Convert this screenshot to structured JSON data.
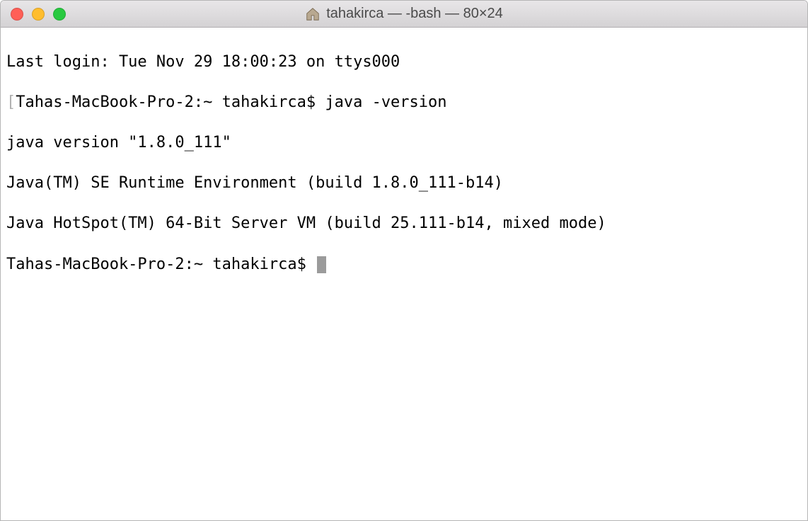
{
  "window": {
    "title": "tahakirca — -bash — 80×24"
  },
  "terminal": {
    "line1": "Last login: Tue Nov 29 18:00:23 on ttys000",
    "line2_prompt": "Tahas-MacBook-Pro-2:~ tahakirca$ ",
    "line2_cmd": "java -version",
    "line3": "java version \"1.8.0_111\"",
    "line4": "Java(TM) SE Runtime Environment (build 1.8.0_111-b14)",
    "line5": "Java HotSpot(TM) 64-Bit Server VM (build 25.111-b14, mixed mode)",
    "line6_prompt": "Tahas-MacBook-Pro-2:~ tahakirca$ "
  }
}
